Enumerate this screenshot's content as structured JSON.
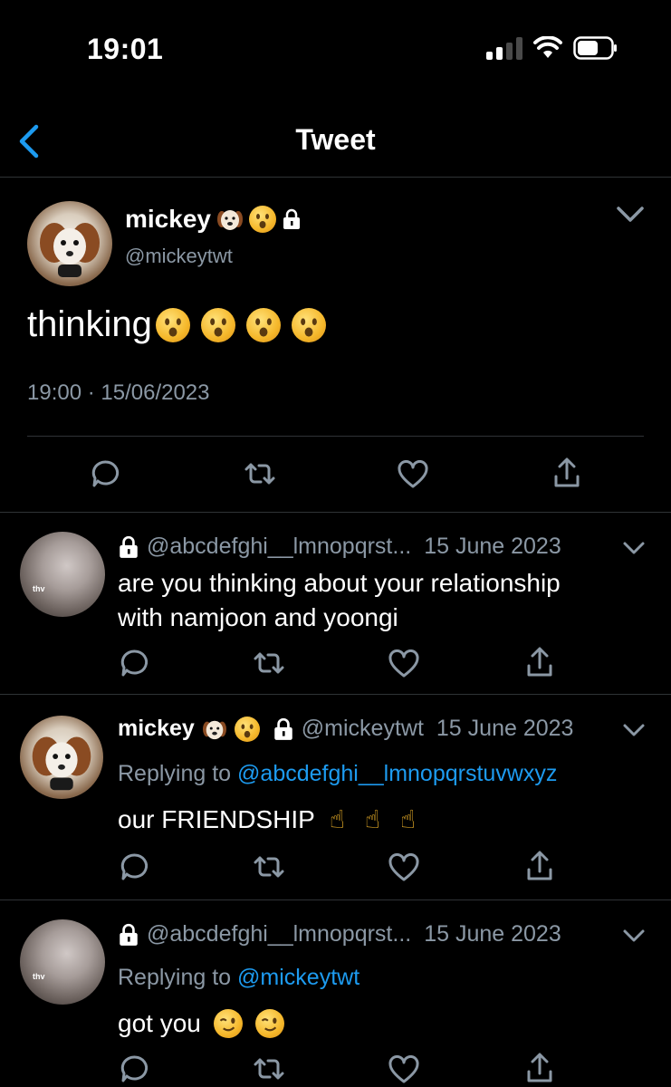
{
  "status_bar": {
    "time": "19:01"
  },
  "nav": {
    "title": "Tweet"
  },
  "main_tweet": {
    "name": "mickey",
    "handle": "@mickeytwt",
    "text": "thinking",
    "timestamp": "19:00 · 15/06/2023"
  },
  "replies": [
    {
      "handle": "@abcdefghi__lmnopqrst...",
      "date": "15 June 2023",
      "text_line1": "are you thinking about your relationship",
      "text_line2": "with namjoon and yoongi",
      "avatar_caption": "thv"
    },
    {
      "name": "mickey",
      "handle": "@mickeytwt",
      "date": "15 June 2023",
      "replying_label": "Replying to",
      "replying_to": "@abcdefghi__lmnopqrstuvwxyz",
      "text": "our FRIENDSHIP"
    },
    {
      "handle": "@abcdefghi__lmnopqrst...",
      "date": "15 June 2023",
      "replying_label": "Replying to",
      "replying_to": "@mickeytwt",
      "text": "got you",
      "avatar_caption": "thv"
    }
  ],
  "colors": {
    "background": "#000000",
    "accent": "#1d9bf0",
    "secondary_text": "#8b98a5",
    "divider": "#2f3336"
  }
}
